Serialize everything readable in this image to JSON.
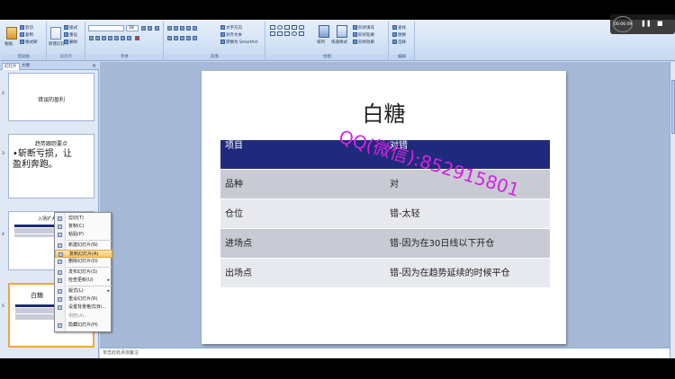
{
  "ribbon": {
    "groups": [
      "剪贴板",
      "幻灯片",
      "字体",
      "段落",
      "绘图",
      "编辑"
    ],
    "paste": "粘贴",
    "cut": "剪切",
    "copy": "复制",
    "format_painter": "格式刷",
    "new_slide": "新建幻灯片",
    "layout": "版式",
    "reset": "重设",
    "delete": "删除",
    "font_size": "18",
    "text_direction": "文字方向",
    "align_text": "对齐文本",
    "smartart": "转换为 SmartArt",
    "arrange": "排列",
    "quick_styles": "快速样式",
    "shape_fill": "形状填充",
    "shape_outline": "形状轮廓",
    "shape_effects": "形状效果",
    "find": "查找",
    "replace": "替换",
    "select": "选择"
  },
  "leftpanel": {
    "tab_slides": "幻灯片",
    "tab_outline": "大纲",
    "close": "×",
    "thumbs": [
      {
        "num": "2",
        "title": "错误的盈利"
      },
      {
        "num": "3",
        "title": "趋势跟踪要点",
        "body": "•斩断亏损，让盈利奔跑。"
      },
      {
        "num": "4",
        "title": "入场扩大二次"
      },
      {
        "num": "5",
        "title": "白糖"
      }
    ]
  },
  "context_menu": {
    "items": [
      {
        "label": "剪切(T)",
        "state": "normal"
      },
      {
        "label": "复制(C)",
        "state": "normal"
      },
      {
        "label": "粘贴(P)",
        "state": "normal"
      },
      {
        "label": "新建幻灯片(N)",
        "state": "normal"
      },
      {
        "label": "复制幻灯片(A)",
        "state": "highlight"
      },
      {
        "label": "删除幻灯片(D)",
        "state": "normal"
      },
      {
        "label": "发布幻灯片(S)",
        "state": "normal"
      },
      {
        "label": "检查更新(U)",
        "state": "normal",
        "submenu": true
      },
      {
        "label": "版式(L)",
        "state": "normal",
        "submenu": true
      },
      {
        "label": "重设幻灯片(R)",
        "state": "normal"
      },
      {
        "label": "设置背景格式(B)...",
        "state": "normal"
      },
      {
        "label": "相册(A)...",
        "state": "disabled"
      },
      {
        "label": "隐藏幻灯片(H)",
        "state": "normal"
      }
    ]
  },
  "slide": {
    "title": "白糖",
    "header": [
      "项目",
      "对错"
    ],
    "rows": [
      [
        "品种",
        "对"
      ],
      [
        "仓位",
        "错-太轻"
      ],
      [
        "进场点",
        "错-因为在30日线以下开仓"
      ],
      [
        "出场点",
        "错-因为在趋势延续的时候平仓"
      ]
    ]
  },
  "watermark": "QQ(微信):852915801",
  "notes_placeholder": "单击此处添加备注",
  "player": {
    "time": "00:06:09",
    "pause": "❚❚",
    "fullscreen": "■"
  }
}
